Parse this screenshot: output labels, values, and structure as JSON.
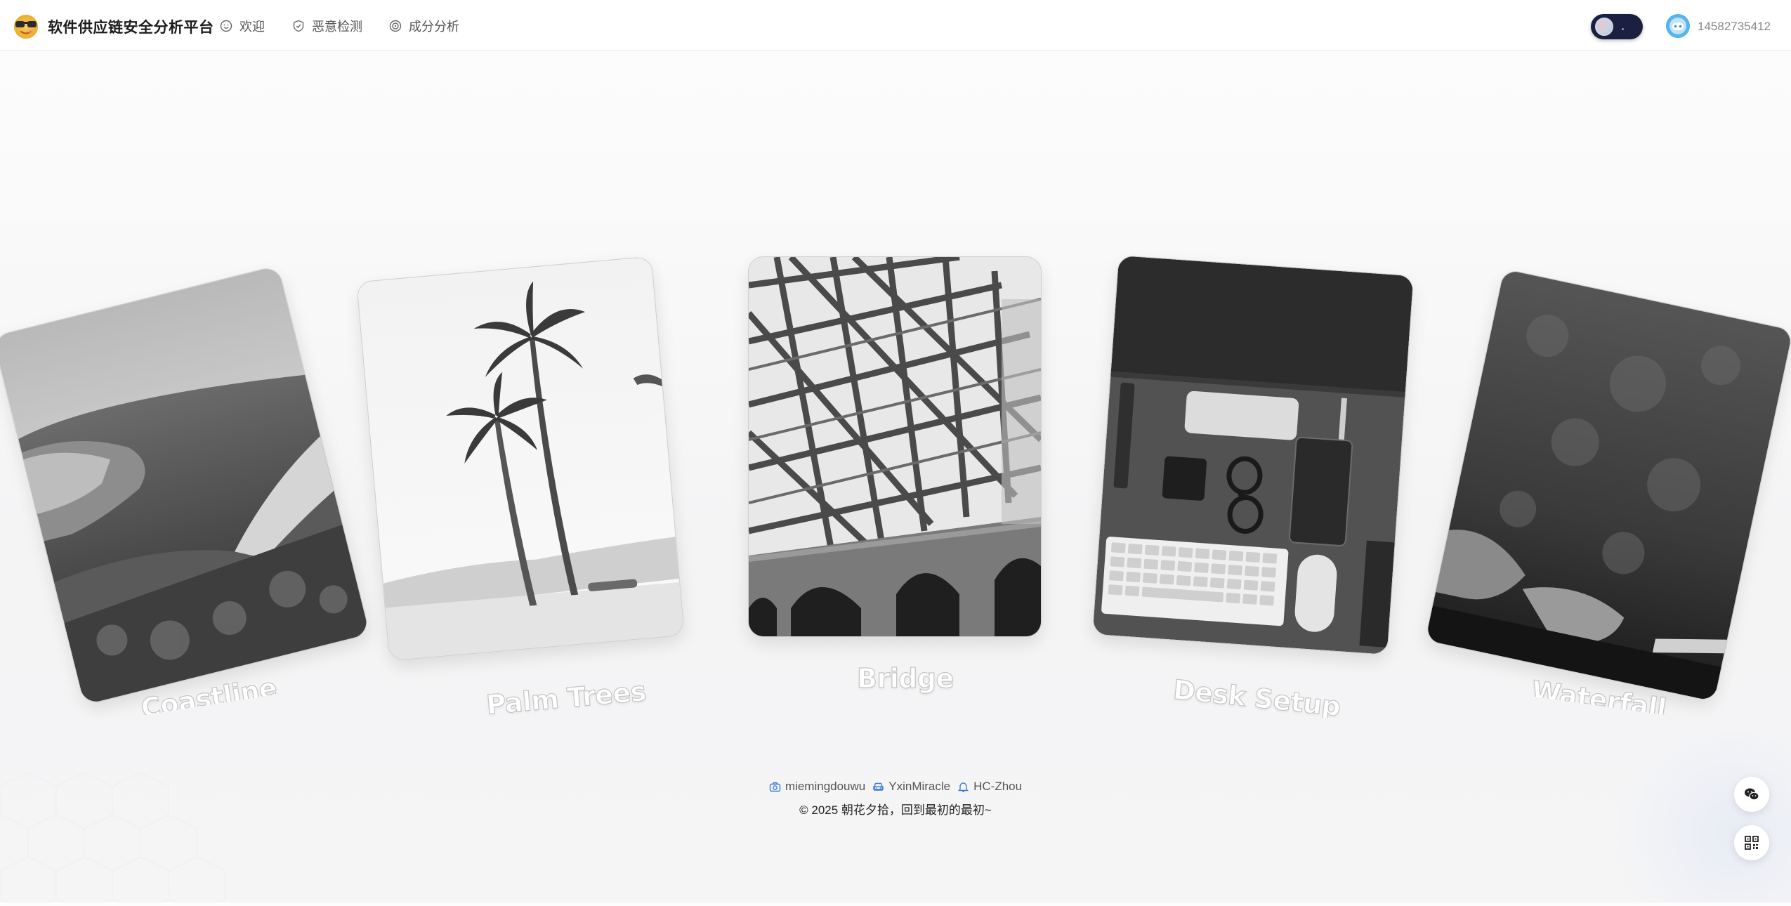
{
  "header": {
    "brand": "软件供应链安全分析平台",
    "nav": [
      {
        "label": "欢迎",
        "icon": "smile-icon"
      },
      {
        "label": "恶意检测",
        "icon": "shield-icon"
      },
      {
        "label": "成分分析",
        "icon": "target-icon"
      }
    ],
    "username": "14582735412",
    "theme": "dark-toggle"
  },
  "carousel": {
    "cards": [
      {
        "caption": "Coastline",
        "image": "coastline-photo"
      },
      {
        "caption": "Palm Trees",
        "image": "palm-trees-photo"
      },
      {
        "caption": "Bridge",
        "image": "bridge-photo"
      },
      {
        "caption": "Desk Setup",
        "image": "desk-setup-photo"
      },
      {
        "caption": "Waterfall",
        "image": "waterfall-rock-photo"
      }
    ]
  },
  "footer": {
    "links": [
      {
        "label": "miemingdouwu",
        "icon": "camera-icon"
      },
      {
        "label": "YxinMiracle",
        "icon": "car-icon"
      },
      {
        "label": "HC-Zhou",
        "icon": "bell-icon"
      }
    ],
    "copyright_symbol": "©",
    "copyright": "2025 朝花夕拾，回到最初的最初~"
  },
  "colors": {
    "accent": "#3a7bd5",
    "toggle_bg": "#1b2040",
    "avatar": "#56b4ef"
  }
}
